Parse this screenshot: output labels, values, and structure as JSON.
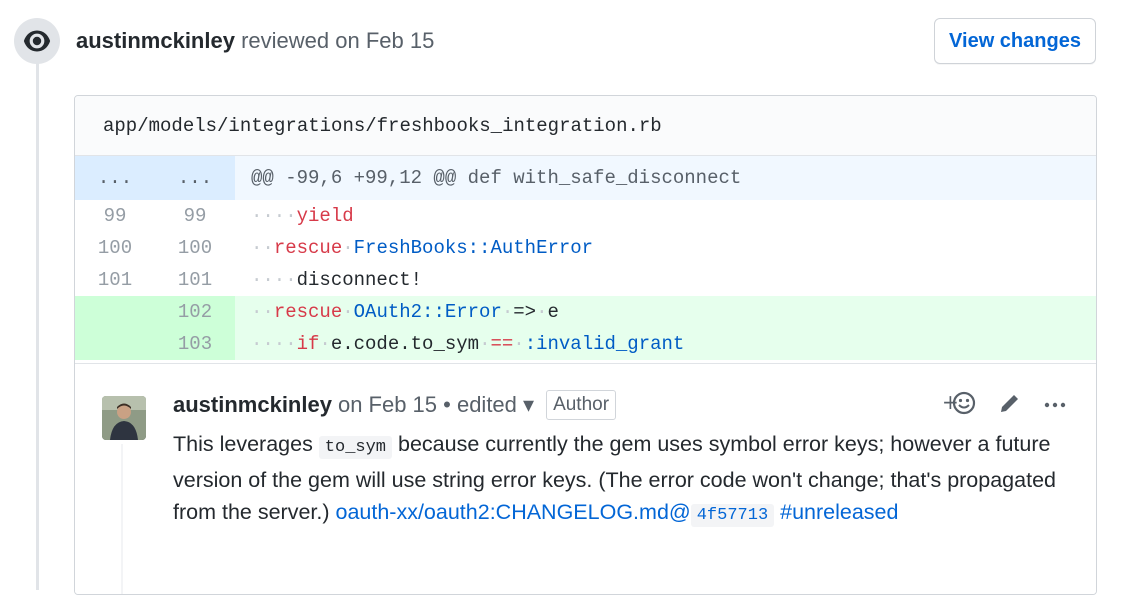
{
  "review": {
    "author": "austinmckinley",
    "meta": "reviewed on Feb 15",
    "view_changes": "View changes"
  },
  "file": {
    "path": "app/models/integrations/freshbooks_integration.rb"
  },
  "diff": {
    "hunk": {
      "old": "...",
      "new": "...",
      "text": "@@ -99,6 +99,12 @@ def with_safe_disconnect"
    },
    "lines": [
      {
        "old": "99",
        "new": "99",
        "type": "context"
      },
      {
        "old": "100",
        "new": "100",
        "type": "context"
      },
      {
        "old": "101",
        "new": "101",
        "type": "context"
      },
      {
        "old": "",
        "new": "102",
        "type": "added"
      },
      {
        "old": "",
        "new": "103",
        "type": "added"
      }
    ],
    "tokens": {
      "l1_kw": "yield",
      "l2_kw": "rescue",
      "l2_cls": "FreshBooks::AuthError",
      "l3_text": "disconnect!",
      "l4_kw": "rescue",
      "l4_cls": "OAuth2::Error",
      "l4_op": "=>",
      "l4_var": "e",
      "l5_kw": "if",
      "l5_expr": "e.code.to_sym",
      "l5_op": "==",
      "l5_sym": ":invalid_grant"
    }
  },
  "comment": {
    "author": "austinmckinley",
    "meta": "on Feb 15 • edited ▾",
    "badge": "Author",
    "body_1": "This leverages ",
    "code": "to_sym",
    "body_2": " because currently the gem uses symbol error keys; however a future version of the gem will use string error keys. (The error code won't change; that's propagated from the server.) ",
    "link_1": "oauth-xx/oauth2:CHANGELOG.md@",
    "link_code": "4f57713",
    "link_2": " #unreleased"
  },
  "icons": {
    "eye": "eye-icon",
    "reaction": "add-reaction-icon",
    "edit": "pencil-icon",
    "more": "kebab-horizontal-icon"
  },
  "colors": {
    "link": "#0366d6",
    "added_bg": "#e6ffed",
    "hunk_bg": "#f1f8ff",
    "keyword": "#d73a49",
    "constant": "#005cc5"
  }
}
